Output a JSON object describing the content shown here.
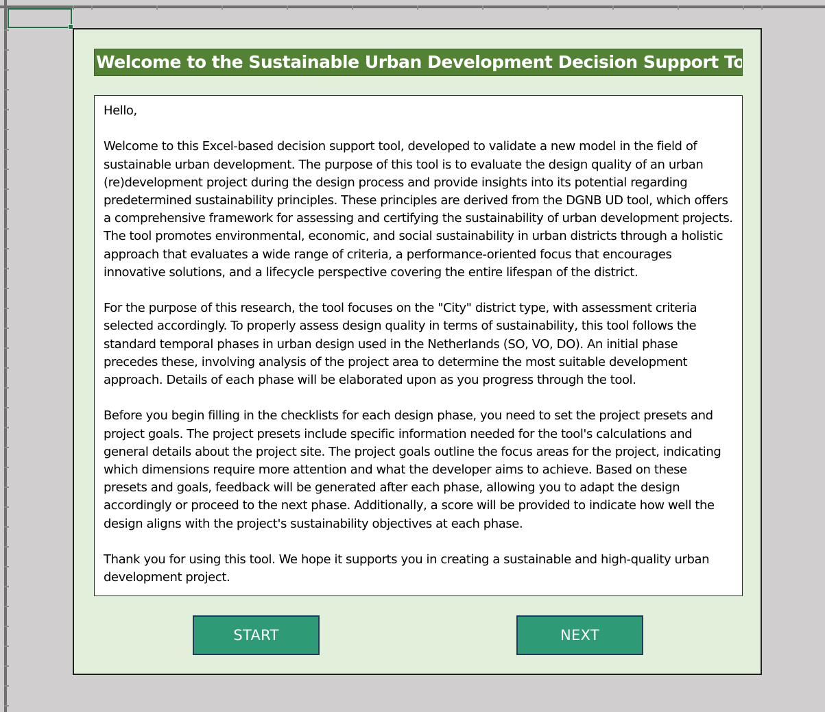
{
  "welcome_form": {
    "title": "Welcome to the Sustainable Urban Development Decision Support Tool",
    "paragraphs": [
      "Hello,",
      "Welcome to this Excel-based decision support tool, developed to validate a new model in the field of sustainable urban development. The purpose of this tool is to evaluate the design quality of an urban (re)development project during the design process and provide insights into its potential regarding predetermined sustainability principles. These principles are derived from the DGNB UD tool, which offers a comprehensive framework for assessing and certifying the sustainability of urban development projects. The tool promotes environmental, economic, and social sustainability in urban districts through a holistic approach that evaluates a wide range of criteria, a performance-oriented focus that encourages innovative solutions, and a lifecycle perspective covering the entire lifespan of the district.",
      "For the purpose of this research, the tool focuses on the \"City\" district type, with assessment criteria selected accordingly. To properly assess design quality in terms of sustainability, this tool follows the standard temporal phases in urban design used in the Netherlands (SO, VO, DO). An initial phase precedes these, involving analysis of the project area to determine the most suitable development approach. Details of each phase will be elaborated upon as you progress through the tool.",
      "Before you begin filling in the checklists for each design phase, you need to set the project presets and project goals. The project presets include specific information needed for the tool's calculations and general details about the project site. The project goals outline the focus areas for the project, indicating which dimensions require more attention and what the developer aims to achieve. Based on these presets and goals, feedback will be generated after each phase, allowing you to adapt the design accordingly or proceed to the next phase. Additionally, a score will be provided to indicate how well the design aligns with the project's sustainability objectives at each phase.",
      "Thank you for using this tool. We hope it supports you in creating a sustainable and high-quality urban development project."
    ],
    "buttons": {
      "start_label": "START",
      "next_label": "NEXT"
    }
  },
  "colors": {
    "title_background": "#548235",
    "panel_background": "#e2efda",
    "button_background": "#2e9b76",
    "button_border": "#1c3d5e",
    "sheet_background": "#d0cecf",
    "selection_border": "#217346"
  }
}
